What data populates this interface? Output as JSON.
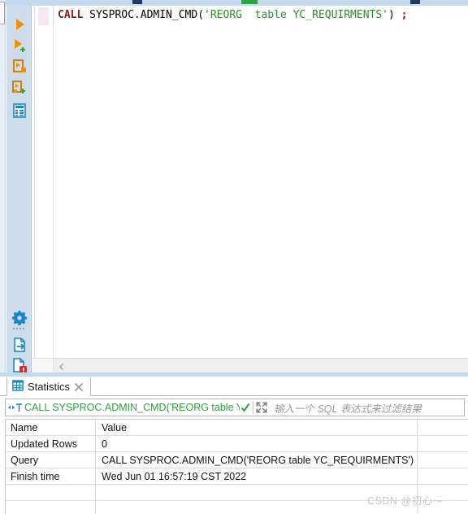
{
  "window": {
    "app_kind": "sql-editor"
  },
  "top_toolbar": {
    "fragment_icons": [
      "toolbar-fragment-dark",
      "toolbar-fragment-green",
      "toolbar-fragment-dark"
    ]
  },
  "left_toolbar": {
    "items": [
      {
        "name": "run-sql-button",
        "icon": "play-icon",
        "tooltip": "Execute SQL"
      },
      {
        "name": "run-sql-new-button",
        "icon": "play-plus-icon",
        "tooltip": "Execute SQL in new tab"
      },
      {
        "name": "run-script-button",
        "icon": "script-run-icon",
        "tooltip": "Execute SQL script"
      },
      {
        "name": "run-script-new-button",
        "icon": "script-run-plus-icon",
        "tooltip": "Execute script in new tab"
      },
      {
        "name": "explain-plan-button",
        "icon": "grid-plan-icon",
        "tooltip": "Explain execution plan"
      },
      {
        "name": "settings-button",
        "icon": "gear-icon",
        "tooltip": "Settings"
      },
      {
        "name": "export-data-button",
        "icon": "export-file-icon",
        "tooltip": "Export data"
      },
      {
        "name": "error-log-button",
        "icon": "file-error-icon",
        "tooltip": "Errors"
      }
    ]
  },
  "editor": {
    "statement": {
      "full_text": "CALL SYSPROC.ADMIN_CMD('REORG  table YC_REQUIRMENTS') ;",
      "tokens": [
        {
          "text": "CALL",
          "type": "keyword"
        },
        {
          "text": " SYSPROC.ADMIN_CMD(",
          "type": "plain"
        },
        {
          "text": "'REORG  table YC_REQUIRMENTS'",
          "type": "string"
        },
        {
          "text": ")",
          "type": "plain"
        },
        {
          "text": " ",
          "type": "plain"
        },
        {
          "text": ";",
          "type": "semicolon"
        }
      ]
    },
    "scroll_left_arrow": "chevron-left-icon"
  },
  "results_panel": {
    "tab": {
      "label": "Statistics",
      "icon": "grid-icon",
      "close_icon": "close-icon",
      "active": true
    },
    "filter_bar": {
      "type_icon": "filter-text-icon",
      "query_text": "CALL SYSPROC.ADMIN_CMD('REORG table YC_REQUIRM",
      "valid_icon": "check-icon",
      "expand_icon": "expand-icon",
      "placeholder": "输入一个 SQL 表达式来过滤结果"
    },
    "table": {
      "columns": [
        "Name",
        "Value",
        ""
      ],
      "rows": [
        {
          "name": "Name",
          "value": "Value",
          "extra": ""
        },
        {
          "name": "Updated Rows",
          "value": "0",
          "extra": ""
        },
        {
          "name": "Query",
          "value": "CALL SYSPROC.ADMIN_CMD('REORG  table YC_REQUIRMENTS')",
          "extra": ""
        },
        {
          "name": "Finish time",
          "value": "Wed Jun 01 16:57:19 CST 2022",
          "extra": ""
        },
        {
          "name": "",
          "value": "",
          "extra": ""
        },
        {
          "name": "",
          "value": "",
          "extra": ""
        }
      ]
    }
  },
  "watermark": {
    "text": "CSDN @初心⁓"
  },
  "colors": {
    "chrome_blue": "#c5d9ee",
    "toolbar_blue": "#cfdcec",
    "icon_orange": "#f29100",
    "icon_blue": "#1a86c8",
    "keyword_red": "#8b1a1a",
    "string_green": "#2e8b2e",
    "semicolon_red": "#cc0000",
    "filter_green": "#2f9e41"
  }
}
